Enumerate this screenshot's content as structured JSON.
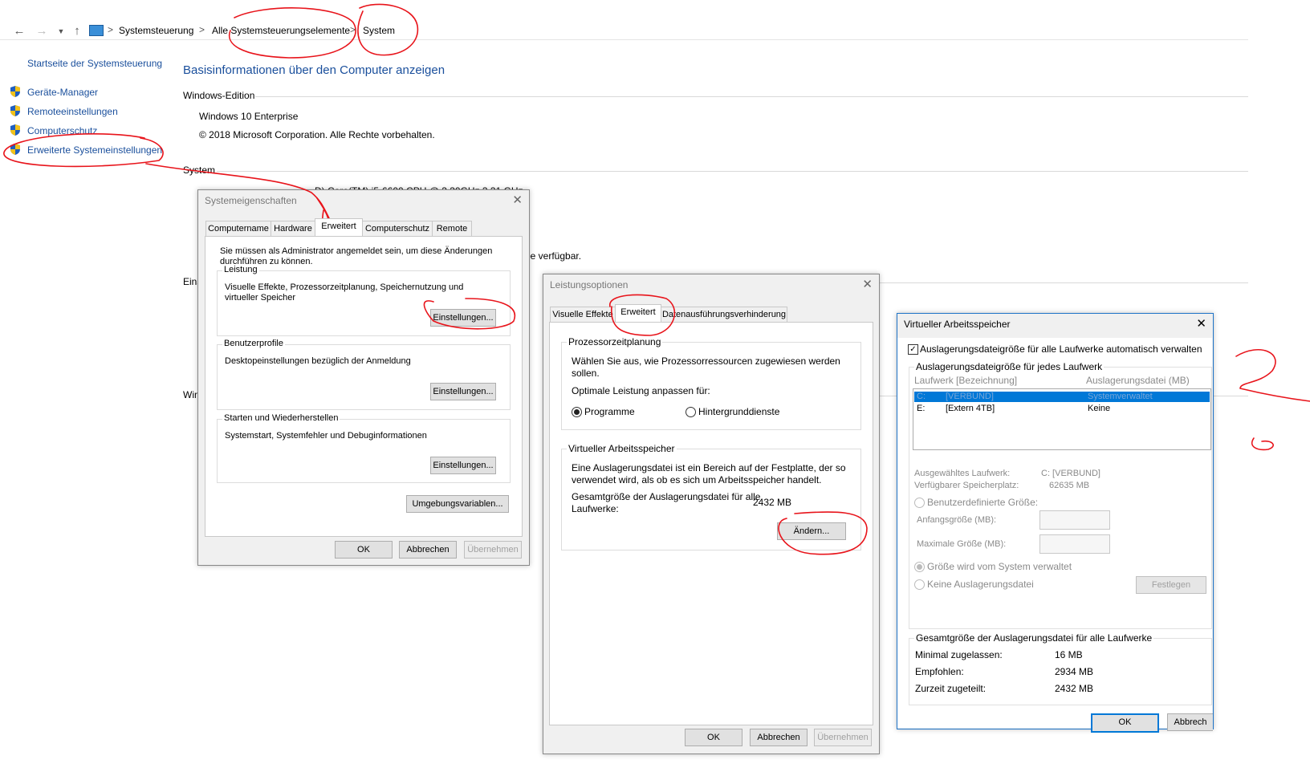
{
  "address_bar": {
    "crumbs": [
      "Systemsteuerung",
      "Alle Systemsteuerungselemente",
      "System"
    ],
    "separator": ">"
  },
  "left_pane": {
    "home": "Startseite der Systemsteuerung",
    "items": [
      {
        "label": "Geräte-Manager",
        "icon": "shield-icon"
      },
      {
        "label": "Remoteeinstellungen",
        "icon": "shield-icon"
      },
      {
        "label": "Computerschutz",
        "icon": "shield-icon"
      },
      {
        "label": "Erweiterte Systemeinstellungen",
        "icon": "shield-icon"
      }
    ]
  },
  "main": {
    "title": "Basisinformationen über den Computer anzeigen",
    "windows_edition_label": "Windows-Edition",
    "edition": "Windows 10 Enterprise",
    "copyright": "© 2018 Microsoft Corporation. Alle Rechte vorbehalten.",
    "system_label": "System",
    "processor_tail": "D) Core(TM) i5-6600 CPU @ 3.30GHz   3.31 GHz",
    "pen_tail": "be verfügbar.",
    "settings_stub": "Eins",
    "windows_stub": "Win"
  },
  "systemeigenschaften": {
    "title": "Systemeigenschaften",
    "tabs": [
      "Computername",
      "Hardware",
      "Erweitert",
      "Computerschutz",
      "Remote"
    ],
    "admin_note": "Sie müssen als Administrator angemeldet sein, um diese Änderungen durchführen zu können.",
    "leistung": {
      "label": "Leistung",
      "text": "Visuelle Effekte, Prozessorzeitplanung, Speichernutzung und virtueller Speicher",
      "button": "Einstellungen..."
    },
    "benutzerprofile": {
      "label": "Benutzerprofile",
      "text": "Desktopeinstellungen bezüglich der Anmeldung",
      "button": "Einstellungen..."
    },
    "starten": {
      "label": "Starten und Wiederherstellen",
      "text": "Systemstart, Systemfehler und Debuginformationen",
      "button": "Einstellungen..."
    },
    "env_button": "Umgebungsvariablen...",
    "ok": "OK",
    "cancel": "Abbrechen",
    "apply": "Übernehmen"
  },
  "leistungsoptionen": {
    "title": "Leistungsoptionen",
    "tabs": [
      "Visuelle Effekte",
      "Erweitert",
      "Datenausführungsverhinderung"
    ],
    "cpu_group": {
      "label": "Prozessorzeitplanung",
      "text": "Wählen Sie aus, wie Prozessorressourcen zugewiesen werden sollen.",
      "optimize": "Optimale Leistung anpassen für:",
      "radio_programs": "Programme",
      "radio_services": "Hintergrunddienste"
    },
    "vm_group": {
      "label": "Virtueller Arbeitsspeicher",
      "text": "Eine Auslagerungsdatei ist ein Bereich auf der Festplatte, der so verwendet wird, als ob es sich um Arbeitsspeicher handelt.",
      "total_label": "Gesamtgröße der Auslagerungsdatei für alle Laufwerke:",
      "total_value": "2432 MB",
      "change_button": "Ändern..."
    },
    "ok": "OK",
    "cancel": "Abbrechen",
    "apply": "Übernehmen"
  },
  "virtueller_arbeitsspeicher": {
    "title": "Virtueller Arbeitsspeicher",
    "auto_manage": "Auslagerungsdateigröße für alle Laufwerke automatisch verwalten",
    "per_drive_label": "Auslagerungsdateigröße für jedes Laufwerk",
    "col_drive": "Laufwerk [Bezeichnung]",
    "col_pagefile": "Auslagerungsdatei (MB)",
    "drives": [
      {
        "letter": "C:",
        "label": "[VERBUND]",
        "pagefile": "Systemverwaltet"
      },
      {
        "letter": "E:",
        "label": "[Extern 4TB]",
        "pagefile": "Keine"
      }
    ],
    "selected_drive_label": "Ausgewähltes Laufwerk:",
    "selected_drive_value": "C:  [VERBUND]",
    "free_space_label": "Verfügbarer Speicherplatz:",
    "free_space_value": "62635 MB",
    "custom_size": "Benutzerdefinierte Größe:",
    "initial_size": "Anfangsgröße (MB):",
    "max_size": "Maximale Größe (MB):",
    "system_managed": "Größe wird vom System verwaltet",
    "no_pagefile": "Keine Auslagerungsdatei",
    "set_button": "Festlegen",
    "totals_label": "Gesamtgröße der Auslagerungsdatei für alle Laufwerke",
    "min_label": "Minimal zugelassen:",
    "min_value": "16 MB",
    "recommended_label": "Empfohlen:",
    "recommended_value": "2934 MB",
    "allocated_label": "Zurzeit zugeteilt:",
    "allocated_value": "2432 MB",
    "ok": "OK",
    "cancel": "Abbrech"
  },
  "colors": {
    "link": "#1a4f9c",
    "ink": "#e8141b",
    "accent": "#0078d7"
  }
}
